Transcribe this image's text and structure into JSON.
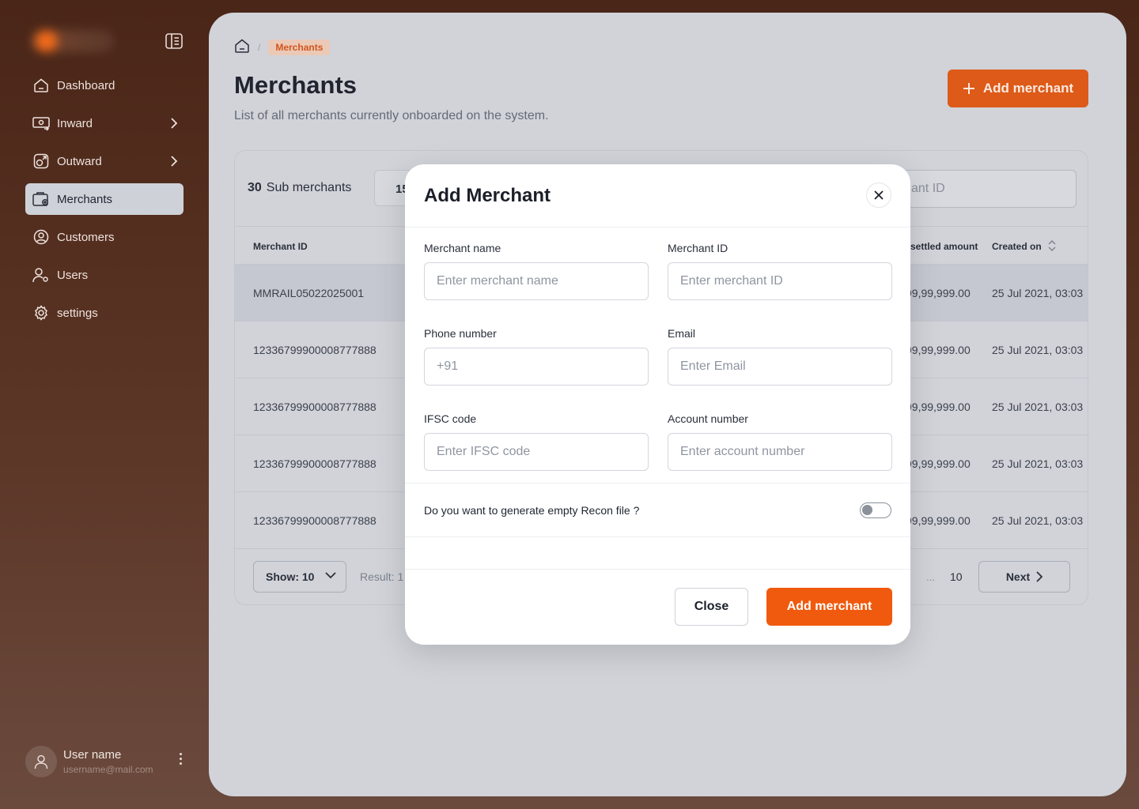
{
  "sidebar": {
    "items": [
      {
        "label": "Dashboard",
        "icon": "home-icon",
        "has_chevron": false
      },
      {
        "label": "Inward",
        "icon": "inward-icon",
        "has_chevron": true
      },
      {
        "label": "Outward",
        "icon": "outward-icon",
        "has_chevron": true
      },
      {
        "label": "Merchants",
        "icon": "merchants-icon",
        "active": true
      },
      {
        "label": "Customers",
        "icon": "customers-icon"
      },
      {
        "label": "Users",
        "icon": "users-icon"
      },
      {
        "label": "settings",
        "icon": "gear-icon"
      }
    ],
    "user": {
      "name": "User name",
      "email": "username@mail.com"
    }
  },
  "breadcrumb": {
    "current": "Merchants",
    "separator": "/"
  },
  "page": {
    "title": "Merchants",
    "subtitle": "List of all merchants currently onboarded on the system.",
    "add_button": "Add merchant"
  },
  "table": {
    "count": "30",
    "count_label": "Sub merchants",
    "tab_value": "15",
    "search_placeholder_visible": "ant ID",
    "columns": {
      "merchant_id": "Merchant ID",
      "settled": "settled amount",
      "created": "Created on"
    },
    "rows": [
      {
        "id": "MMRAIL05022025001",
        "amount": "99,99,999.00",
        "created": "25 Jul 2021, 03:03"
      },
      {
        "id": "12336799900008777888",
        "amount": "99,99,999.00",
        "created": "25 Jul 2021, 03:03"
      },
      {
        "id": "12336799900008777888",
        "amount": "99,99,999.00",
        "created": "25 Jul 2021, 03:03"
      },
      {
        "id": "12336799900008777888",
        "amount": "99,99,999.00",
        "created": "25 Jul 2021, 03:03"
      },
      {
        "id": "12336799900008777888",
        "amount": "99,99,999.00",
        "created": "25 Jul 2021, 03:03"
      }
    ],
    "footer": {
      "show": "Show: 10",
      "result": "Result: 1",
      "ellipsis": "...",
      "last_page": "10",
      "next": "Next"
    }
  },
  "modal": {
    "title": "Add Merchant",
    "fields": {
      "merchant_name": {
        "label": "Merchant name",
        "placeholder": "Enter merchant name"
      },
      "merchant_id": {
        "label": "Merchant ID",
        "placeholder": "Enter merchant ID"
      },
      "phone": {
        "label": "Phone number",
        "placeholder": "+91"
      },
      "email": {
        "label": "Email",
        "placeholder": "Enter Email"
      },
      "ifsc": {
        "label": "IFSC code",
        "placeholder": "Enter IFSC code"
      },
      "account": {
        "label": "Account number",
        "placeholder": "Enter account number"
      }
    },
    "recon_question": "Do you want to generate empty Recon file ?",
    "recon_toggle_on": false,
    "close_button": "Close",
    "submit_button": "Add merchant"
  },
  "colors": {
    "accent": "#f05a0e",
    "accent_dim": "#dd5a18",
    "sidebar_bg": "#4a2618"
  }
}
